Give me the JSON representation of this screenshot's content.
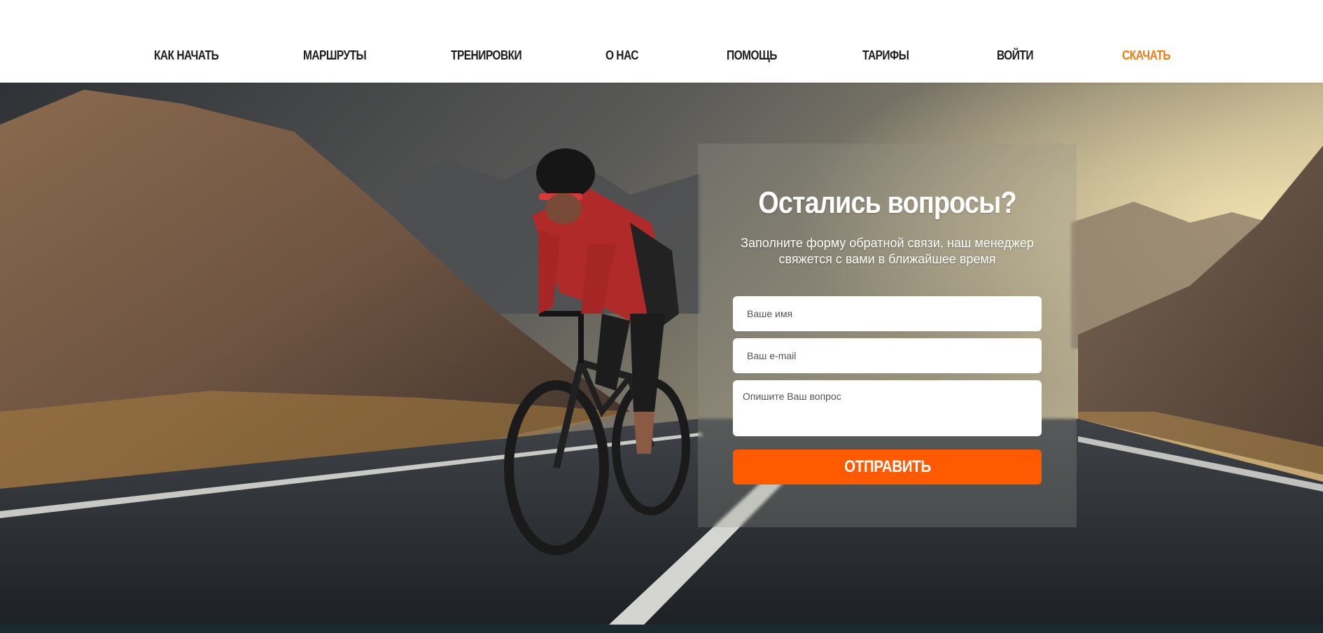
{
  "nav": {
    "items": [
      {
        "label": "КАК НАЧАТЬ"
      },
      {
        "label": "МАРШРУТЫ"
      },
      {
        "label": "ТРЕНИРОВКИ"
      },
      {
        "label": "О НАС"
      },
      {
        "label": "ПОМОЩЬ"
      },
      {
        "label": "ТАРИФЫ"
      },
      {
        "label": "ВОЙТИ"
      },
      {
        "label": "СКАЧАТЬ"
      }
    ],
    "accent_color": "#f07a13"
  },
  "hero": {
    "image": "cyclist-on-mountain-road"
  },
  "feedback": {
    "title": "Остались вопросы?",
    "subtitle": "Заполните форму обратной связи, наш менеджер свяжется с вами в ближайшее время",
    "name_placeholder": "Ваше имя",
    "email_placeholder": "Ваш e-mail",
    "question_placeholder": "Опишите Ваш вопрос",
    "submit_label": "ОТПРАВИТЬ",
    "submit_color": "#ff5a00"
  }
}
